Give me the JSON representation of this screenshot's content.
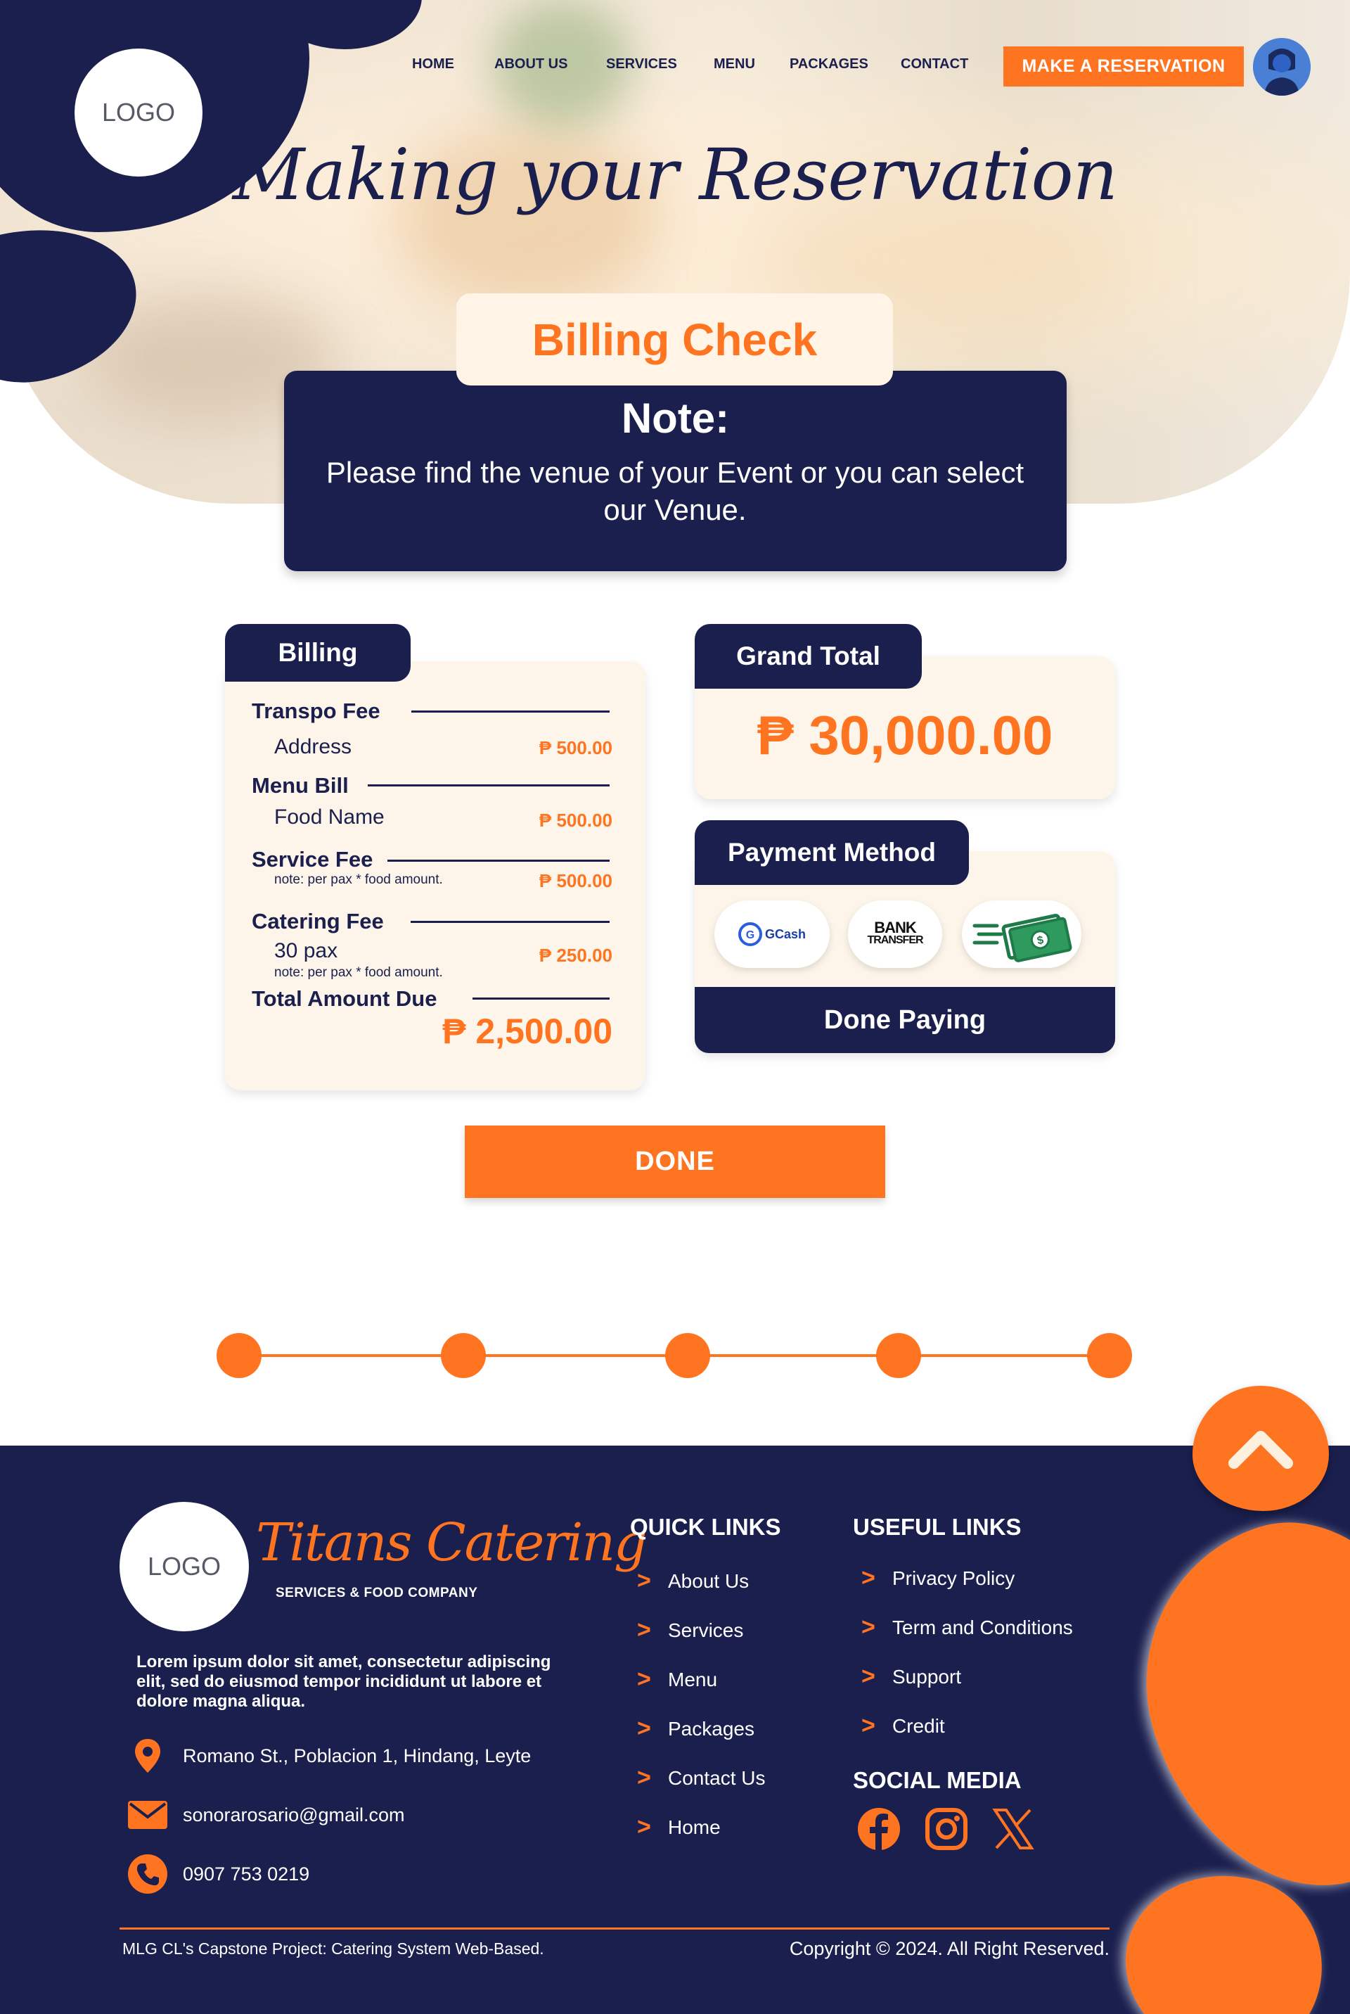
{
  "colors": {
    "navy": "#1a1f4e",
    "orange": "#ff7420",
    "cream": "#fdf5e9"
  },
  "header": {
    "logo_text": "LOGO",
    "nav": [
      "HOME",
      "ABOUT US",
      "SERVICES",
      "MENU",
      "PACKAGES",
      "CONTACT"
    ],
    "reserve_label": "MAKE A RESERVATION",
    "avatar_icon": "user-avatar-icon"
  },
  "hero": {
    "title": "Making your Reservation"
  },
  "billing_check": {
    "tab_label": "Billing Check",
    "note_title": "Note:",
    "note_text": "Please find the venue of your Event or you can select our Venue."
  },
  "billing": {
    "title": "Billing",
    "transpo_label": "Transpo Fee",
    "transpo_sub": "Address",
    "transpo_amount": "₱ 500.00",
    "menu_label": "Menu Bill",
    "menu_sub": "Food Name",
    "menu_amount": "₱ 500.00",
    "service_label": "Service Fee",
    "service_note": "note: per pax * food amount.",
    "service_amount": "₱ 500.00",
    "catering_label": "Catering Fee",
    "catering_sub": "30 pax",
    "catering_note": "note: per pax * food amount.",
    "catering_amount": "₱ 250.00",
    "total_label": "Total Amount Due",
    "total_amount": "₱ 2,500.00"
  },
  "grand_total": {
    "title": "Grand Total",
    "amount": "₱ 30,000.00"
  },
  "payment": {
    "title": "Payment Method",
    "options": [
      "GCash",
      "BANK TRANSFER",
      "cash-icon"
    ],
    "gcash_label": "GCash",
    "bank_line1": "BANK",
    "bank_line2": "TRANSFER",
    "done_label": "Done Paying"
  },
  "done_button": "DONE",
  "stepper": {
    "steps": 5,
    "current": 5
  },
  "footer": {
    "logo_text": "LOGO",
    "brand": "Titans Catering",
    "tagline": "SERVICES & FOOD COMPANY",
    "description": "Lorem ipsum dolor sit amet, consectetur adipiscing elit, sed do eiusmod tempor incididunt ut labore et dolore magna aliqua.",
    "address": "Romano St., Poblacion 1, Hindang, Leyte",
    "email": "sonorarosario@gmail.com",
    "phone": "0907 753 0219",
    "quick_links_title": "QUICK LINKS",
    "quick_links": [
      "About Us",
      "Services",
      "Menu",
      "Packages",
      "Contact Us",
      "Home"
    ],
    "useful_links_title": "USEFUL LINKS",
    "useful_links": [
      "Privacy Policy",
      "Term and Conditions",
      "Support",
      "Credit"
    ],
    "social_title": "SOCIAL MEDIA",
    "social_icons": [
      "facebook-icon",
      "instagram-icon",
      "x-icon"
    ],
    "chevron": ">",
    "bottom_left": "MLG CL's Capstone Project: Catering System Web-Based.",
    "bottom_right": "Copyright © 2024. All Right Reserved."
  }
}
